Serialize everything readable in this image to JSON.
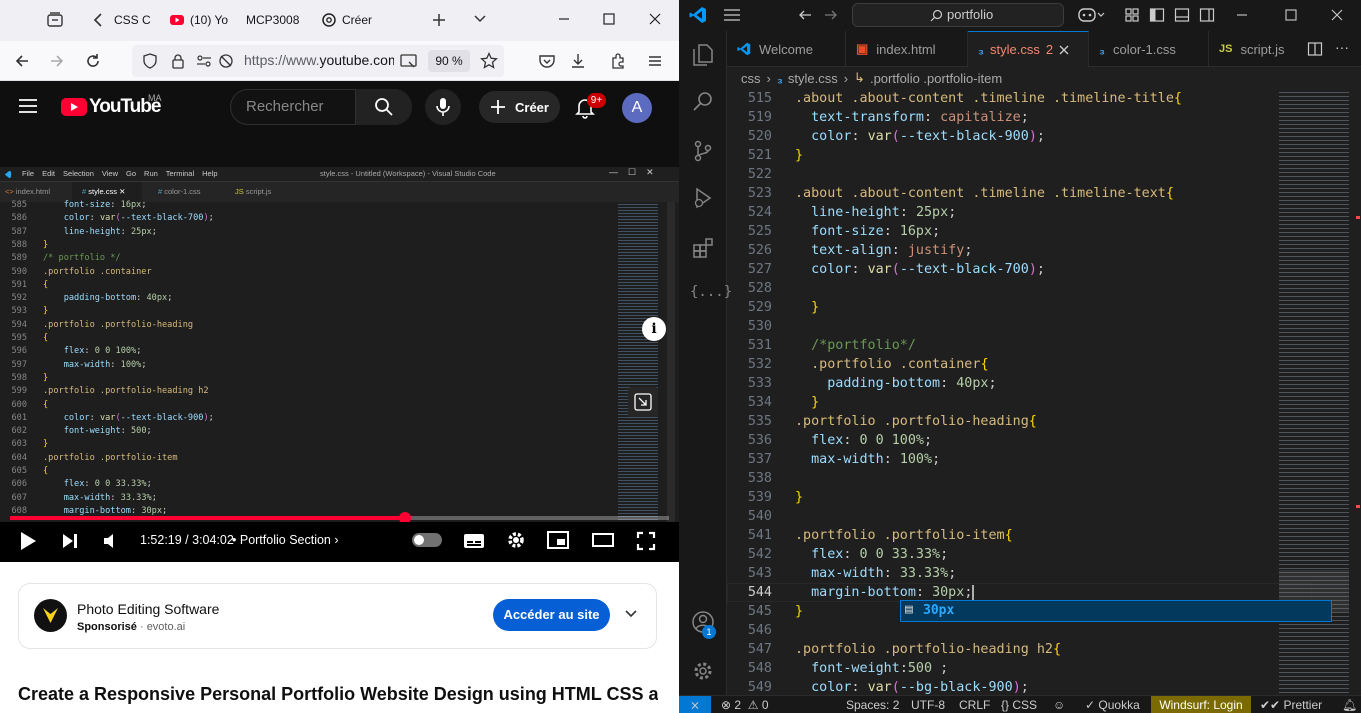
{
  "browser": {
    "tabs": [
      {
        "label": "CSS C"
      },
      {
        "label": "(10) Yo"
      },
      {
        "label": "MCP3008"
      },
      {
        "label": "Créer"
      }
    ],
    "url_prefix": "https://www.",
    "url_domain": "youtube.com",
    "zoom": "90 %"
  },
  "youtube": {
    "logo_text": "YouTube",
    "region": "MA",
    "search_placeholder": "Rechercher",
    "create_label": "Créer",
    "notif_badge": "9+",
    "avatar_letter": "A",
    "player": {
      "time": "1:52:19 / 3:04:02",
      "chapter": "Portfolio Section",
      "progress": 0.6
    },
    "ad": {
      "title": "Photo Editing Software",
      "sponsored": "Sponsorisé",
      "domain": "evoto.ai",
      "cta": "Accéder au site"
    },
    "video_title": "Create a Responsive Personal Portfolio Website Design using HTML CSS and"
  },
  "inner_vscode": {
    "menu": [
      "File",
      "Edit",
      "Selection",
      "View",
      "Go",
      "Run",
      "Terminal",
      "Help"
    ],
    "title": "style.css - Untitled (Workspace) - Visual Studio Code",
    "tabs": [
      "index.html",
      "style.css",
      "color-1.css",
      "script.js"
    ],
    "lines": [
      {
        "n": "585",
        "t": "    font-size: 16px;"
      },
      {
        "n": "586",
        "t": "    color: var(--text-black-700);"
      },
      {
        "n": "587",
        "t": "    line-height: 25px;"
      },
      {
        "n": "588",
        "t": "}"
      },
      {
        "n": "589",
        "t": "/* portfolio */"
      },
      {
        "n": "590",
        "t": ".portfolio .container"
      },
      {
        "n": "591",
        "t": "{"
      },
      {
        "n": "592",
        "t": "    padding-bottom: 40px;"
      },
      {
        "n": "593",
        "t": "}"
      },
      {
        "n": "594",
        "t": ".portfolio .portfolio-heading"
      },
      {
        "n": "595",
        "t": "{"
      },
      {
        "n": "596",
        "t": "    flex: 0 0 100%;"
      },
      {
        "n": "597",
        "t": "    max-width: 100%;"
      },
      {
        "n": "598",
        "t": "}"
      },
      {
        "n": "599",
        "t": ".portfolio .portfolio-heading h2"
      },
      {
        "n": "600",
        "t": "{"
      },
      {
        "n": "601",
        "t": "    color: var(--text-black-900);"
      },
      {
        "n": "602",
        "t": "    font-weight: 500;"
      },
      {
        "n": "603",
        "t": "}"
      },
      {
        "n": "604",
        "t": ".portfolio .portfolio-item"
      },
      {
        "n": "605",
        "t": "{"
      },
      {
        "n": "606",
        "t": "    flex: 0 0 33.33%;"
      },
      {
        "n": "607",
        "t": "    max-width: 33.33%;"
      },
      {
        "n": "608",
        "t": "    margin-bottom: 30px;"
      }
    ]
  },
  "vscode": {
    "search_text": "portfolio",
    "tabs": [
      {
        "label": "Welcome"
      },
      {
        "label": "index.html"
      },
      {
        "label": "style.css",
        "badge": "2"
      },
      {
        "label": "color-1.css"
      },
      {
        "label": "script.js"
      }
    ],
    "breadcrumb": [
      "css",
      "style.css",
      ".portfolio .portfolio-item"
    ],
    "lines": [
      {
        "n": "515",
        "t": ".about .about-content .timeline .timeline-title{"
      },
      {
        "n": "519",
        "t": "  text-transform: capitalize;"
      },
      {
        "n": "520",
        "t": "  color: var(--text-black-900);"
      },
      {
        "n": "521",
        "t": "}"
      },
      {
        "n": "522",
        "t": ""
      },
      {
        "n": "523",
        "t": ".about .about-content .timeline .timeline-text{"
      },
      {
        "n": "524",
        "t": "  line-height: 25px;"
      },
      {
        "n": "525",
        "t": "  font-size: 16px;"
      },
      {
        "n": "526",
        "t": "  text-align: justify;"
      },
      {
        "n": "527",
        "t": "  color: var(--text-black-700);"
      },
      {
        "n": "528",
        "t": ""
      },
      {
        "n": "529",
        "t": "  }"
      },
      {
        "n": "530",
        "t": ""
      },
      {
        "n": "531",
        "t": "  /*portfolio*/"
      },
      {
        "n": "532",
        "t": "  .portfolio .container{"
      },
      {
        "n": "533",
        "t": "    padding-bottom: 40px;"
      },
      {
        "n": "534",
        "t": "  }"
      },
      {
        "n": "535",
        "t": ".portfolio .portfolio-heading{"
      },
      {
        "n": "536",
        "t": "  flex: 0 0 100%;"
      },
      {
        "n": "537",
        "t": "  max-width: 100%;"
      },
      {
        "n": "538",
        "t": ""
      },
      {
        "n": "539",
        "t": "}"
      },
      {
        "n": "540",
        "t": ""
      },
      {
        "n": "541",
        "t": ".portfolio .portfolio-item{"
      },
      {
        "n": "542",
        "t": "  flex: 0 0 33.33%;"
      },
      {
        "n": "543",
        "t": "  max-width: 33.33%;"
      },
      {
        "n": "544",
        "t": "  margin-bottom: 30px;"
      },
      {
        "n": "545",
        "t": "}"
      },
      {
        "n": "546",
        "t": ""
      },
      {
        "n": "547",
        "t": ".portfolio .portfolio-heading h2{"
      },
      {
        "n": "548",
        "t": "  font-weight:500 ;"
      },
      {
        "n": "549",
        "t": "  color: var(--bg-black-900);"
      }
    ],
    "suggestion": "30px",
    "status": {
      "errors": "2",
      "warnings": "0",
      "spaces": "Spaces: 2",
      "encoding": "UTF-8",
      "eol": "CRLF",
      "language": "CSS",
      "quokka": "Quokka",
      "windsurf": "Windsurf: Login",
      "prettier": "Prettier"
    },
    "accounts_badge": "1"
  }
}
